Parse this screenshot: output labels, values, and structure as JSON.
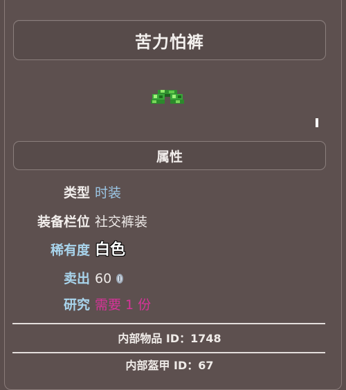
{
  "item": {
    "name": "苦力怕裤",
    "icon": "creeper-pants-sprite-icon"
  },
  "section": {
    "title": "属性"
  },
  "properties": [
    {
      "label": "类型",
      "value": "时装",
      "label_color": "#f2eeec",
      "value_color": "#9cc7e6"
    },
    {
      "label": "装备栏位",
      "value": "社交裤装",
      "label_color": "#f2eeec",
      "value_color": "#eeeae8"
    },
    {
      "label": "稀有度",
      "value": "白色",
      "label_color": "#a8d4ec",
      "value_color": "#ffffff"
    },
    {
      "label": "卖出",
      "value": "60",
      "label_color": "#a8d4ec",
      "value_color": "#eeeae8",
      "icon": "silver-coin-icon"
    },
    {
      "label": "研究",
      "value": "需要 1 份",
      "label_color": "#a8d4ec",
      "value_color": "#d8339a"
    }
  ],
  "footer": {
    "item_id": "内部物品 ID：1748",
    "armor_id": "内部盔甲 ID：67"
  }
}
